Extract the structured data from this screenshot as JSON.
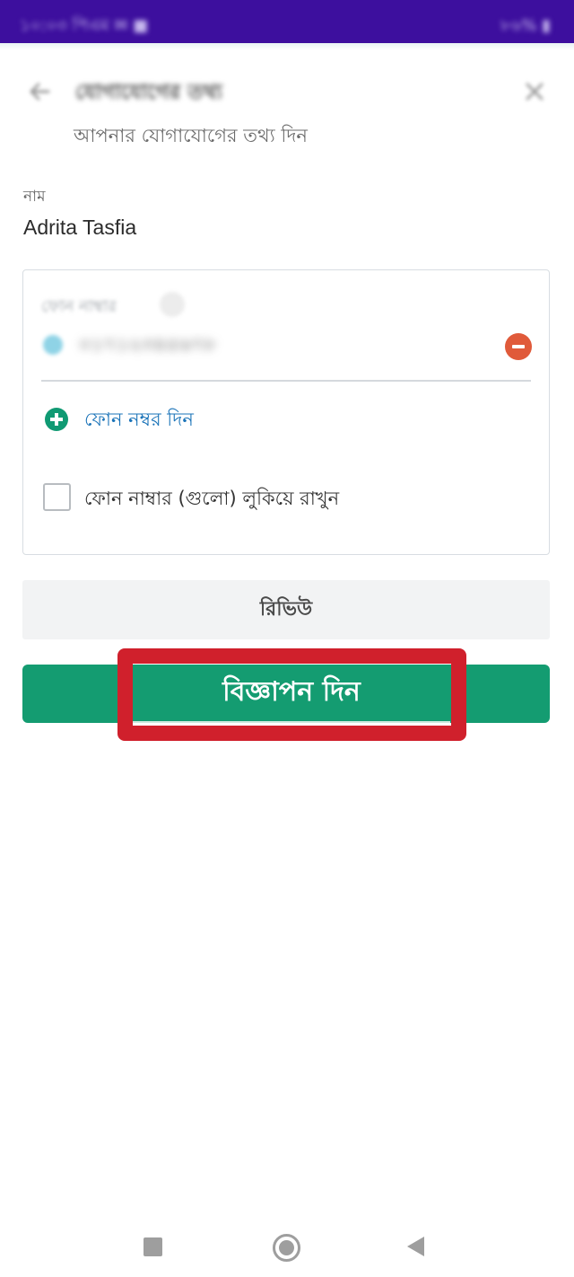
{
  "status_bar": {
    "left_text": "১০:০৩ পিএম ✉ ■",
    "right_text": "৮৬% ▮"
  },
  "header": {
    "title": "যোগাযোগের তথ্য",
    "subtitle": "আপনার যোগাযোগের তথ্য দিন"
  },
  "name": {
    "label": "নাম",
    "value": "Adrita Tasfia"
  },
  "phone_section": {
    "label": "ফোন নাম্বার",
    "help_icon": "?",
    "number": "০১৭১২৩৪৫৬৭৮",
    "add_phone_label": "ফোন নম্বর দিন",
    "hide_checkbox_label": "ফোন নাম্বার (গুলো) লুকিয়ে রাখুন",
    "hide_checked": false
  },
  "actions": {
    "review_label": "রিভিউ",
    "post_ad_label": "বিজ্ঞাপন দিন"
  },
  "colors": {
    "status_bar": "#3d0f9e",
    "primary_green": "#149c71",
    "link_blue": "#1a73b8",
    "remove_red": "#e05a3a",
    "highlight_red": "#d0202c"
  },
  "icons": {
    "back": "arrow-left-icon",
    "close": "close-icon",
    "remove": "minus-circle-icon",
    "add": "plus-circle-icon"
  }
}
